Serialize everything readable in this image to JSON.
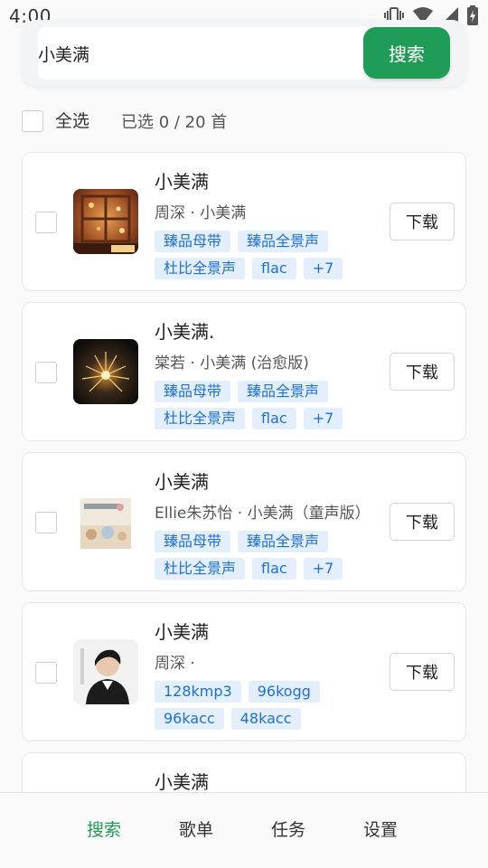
{
  "status_bar": {
    "time": "4:00",
    "icons": [
      "vibrate-icon",
      "wifi-icon",
      "signal-icon",
      "battery-charging-icon"
    ]
  },
  "search": {
    "query": "小美满",
    "button_label": "搜索"
  },
  "selection": {
    "select_all_label": "全选",
    "count_text": "已选 0 / 20 首"
  },
  "results": [
    {
      "title": "小美满",
      "meta": "周深 · 小美满",
      "tags_row1": [
        "臻品母带",
        "臻品全景声"
      ],
      "tags_row2": [
        "杜比全景声",
        "flac",
        "+7"
      ],
      "download_label": "下载"
    },
    {
      "title": "小美满.",
      "meta": "棠若 · 小美满 (治愈版)",
      "tags_row1": [
        "臻品母带",
        "臻品全景声"
      ],
      "tags_row2": [
        "杜比全景声",
        "flac",
        "+7"
      ],
      "download_label": "下载"
    },
    {
      "title": "小美满",
      "meta": "Ellie朱苏怡 · 小美满（童声版）",
      "tags_row1": [
        "臻品母带",
        "臻品全景声"
      ],
      "tags_row2": [
        "杜比全景声",
        "flac",
        "+7"
      ],
      "download_label": "下载"
    },
    {
      "title": "小美满",
      "meta": "周深 ·",
      "tags_row1": [
        "128kmp3",
        "96kogg"
      ],
      "tags_row2": [
        "96kacc",
        "48kacc"
      ],
      "download_label": "下载"
    },
    {
      "title": "小美满"
    }
  ],
  "bottom_nav": {
    "items": [
      "搜索",
      "歌单",
      "任务",
      "设置"
    ],
    "active_index": 0
  },
  "colors": {
    "accent": "#1f9d57",
    "tag_bg": "#e3effc",
    "tag_text": "#1f6fd6"
  }
}
